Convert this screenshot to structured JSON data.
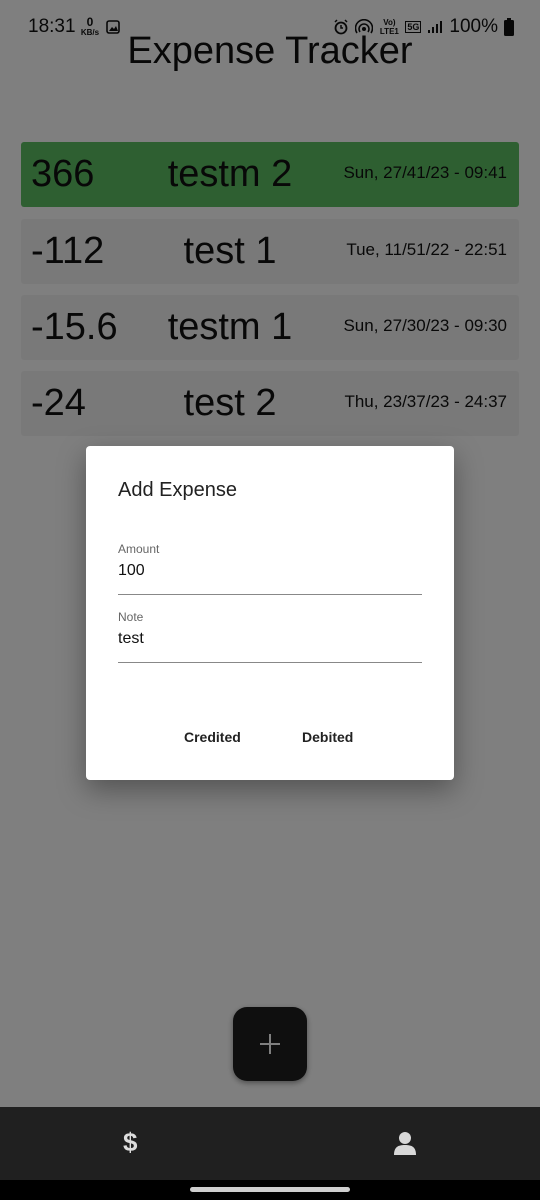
{
  "status_bar": {
    "time": "18:31",
    "data_rate_value": "0",
    "data_rate_unit": "KB/s",
    "network": "5G",
    "volte": "Vo) LTE1",
    "battery": "100%",
    "icons": [
      "gallery-icon",
      "alarm-icon",
      "hotspot-icon",
      "volte-icon",
      "5g-icon",
      "signal-icon",
      "battery-icon"
    ]
  },
  "app": {
    "title": "Expense Tracker"
  },
  "expenses": [
    {
      "amount": "366",
      "note": "testm 2",
      "date": "Sun, 27/41/23 - 09:41",
      "highlight_color": "#5cbf63"
    },
    {
      "amount": "-112",
      "note": "test 1",
      "date": "Tue, 11/51/22 - 22:51"
    },
    {
      "amount": "-15.6",
      "note": "testm 1",
      "date": "Sun, 27/30/23 - 09:30"
    },
    {
      "amount": "-24",
      "note": "test 2",
      "date": "Thu, 23/37/23 - 24:37"
    }
  ],
  "dialog": {
    "title": "Add Expense",
    "amount_label": "Amount",
    "amount_value": "100",
    "note_label": "Note",
    "note_value": "test",
    "credited_label": "Credited",
    "debited_label": "Debited"
  },
  "fab": {
    "icon": "plus-icon"
  },
  "bottom_nav": {
    "items": [
      {
        "icon": "dollar-icon",
        "glyph": "$"
      },
      {
        "icon": "profile-icon"
      }
    ]
  }
}
